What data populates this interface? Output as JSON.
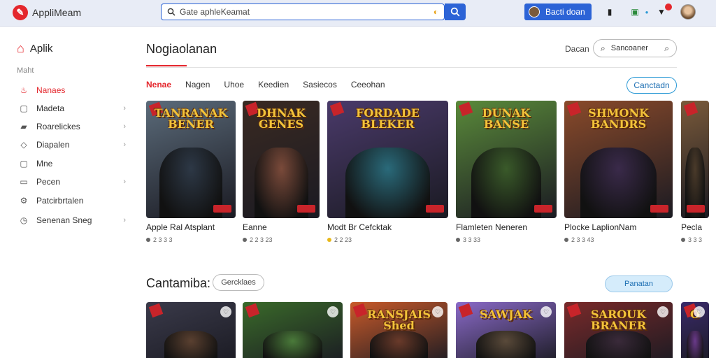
{
  "app": {
    "name": "AppliMeam"
  },
  "search": {
    "placeholder": "Gate aphleKeamat"
  },
  "account_button": {
    "label": "Bacti doan"
  },
  "sidebar": {
    "home_label": "Aplik",
    "section_label": "Maht",
    "items": [
      {
        "label": "Nanaes",
        "icon": "flame-icon",
        "active": true,
        "has_chevron": false
      },
      {
        "label": "Madeta",
        "icon": "box-icon",
        "active": false,
        "has_chevron": true
      },
      {
        "label": "Roarelickes",
        "icon": "folder-icon",
        "active": false,
        "has_chevron": true
      },
      {
        "label": "Diapalen",
        "icon": "chat-icon",
        "active": false,
        "has_chevron": true
      },
      {
        "label": "Mne",
        "icon": "image-icon",
        "active": false,
        "has_chevron": false
      },
      {
        "label": "Pecen",
        "icon": "tag-icon",
        "active": false,
        "has_chevron": true
      },
      {
        "label": "Patcirbrtalen",
        "icon": "gamepad-icon",
        "active": false,
        "has_chevron": false
      },
      {
        "label": "Senenan Sneg",
        "icon": "clock-icon",
        "active": false,
        "has_chevron": true
      }
    ]
  },
  "main": {
    "title": "Nogiaolanan",
    "sort_label": "Dacan",
    "sort_value": "Sancoaner",
    "tabs": [
      {
        "label": "Nenae",
        "active": true
      },
      {
        "label": "Nagen",
        "active": false
      },
      {
        "label": "Uhoe",
        "active": false
      },
      {
        "label": "Keedien",
        "active": false
      },
      {
        "label": "Sasiecos",
        "active": false
      },
      {
        "label": "Ceeohan",
        "active": false
      }
    ],
    "action_button": "Canctadn"
  },
  "games": [
    {
      "logo": "TANRANAK BENER",
      "name": "Apple Ral Atsplant",
      "rating": "2 3 3 3",
      "bg": "#5b6b7a",
      "fig": "#2d3846",
      "gold": false
    },
    {
      "logo": "DHNAK GENES",
      "name": "Eanne",
      "rating": "2 2 3 23",
      "bg": "#3a2a22",
      "fig": "#7a4a3a",
      "gold": false
    },
    {
      "logo": "FORDADE BLEKER",
      "name": "Modt Br Cefcktak",
      "rating": "2 2 23",
      "bg": "#4a3a6a",
      "fig": "#2a6a7a",
      "gold": true
    },
    {
      "logo": "DUNAK BANSE",
      "name": "Flamleten Neneren",
      "rating": "3 3 33",
      "bg": "#5a8a3a",
      "fig": "#3a5a2a",
      "gold": false
    },
    {
      "logo": "SHMONK BANDRS",
      "name": "Plocke LaplionNam",
      "rating": "2 3 3 43",
      "bg": "#8a4a2a",
      "fig": "#3a2a4a",
      "gold": false
    },
    {
      "logo": "",
      "name": "Pecla",
      "rating": "3 3 3",
      "bg": "#7a5a3a",
      "fig": "#4a3a2a",
      "gold": false
    }
  ],
  "section2": {
    "title": "Cantamiba:",
    "chip": "Gercklaes",
    "button": "Panatan"
  },
  "games2": [
    {
      "logo": "",
      "bg": "#3a3a4a",
      "fig": "#5a4030"
    },
    {
      "logo": "",
      "bg": "#3a6a2a",
      "fig": "#4a7a3a"
    },
    {
      "logo": "RANSJAIS Shed",
      "bg": "#c85a2a",
      "fig": "#6a3a2a"
    },
    {
      "logo": "SAWJAK",
      "bg": "#8a6ac8",
      "fig": "#5a4a3a"
    },
    {
      "logo": "SAROUK BRANER",
      "bg": "#7a2a2a",
      "fig": "#3a2a3a"
    },
    {
      "logo": "O",
      "bg": "#3a2a6a",
      "fig": "#6a3a8a"
    }
  ],
  "colors": {
    "accent": "#e4272d",
    "primary": "#2c63d6",
    "topbar": "#e8ecf6"
  }
}
